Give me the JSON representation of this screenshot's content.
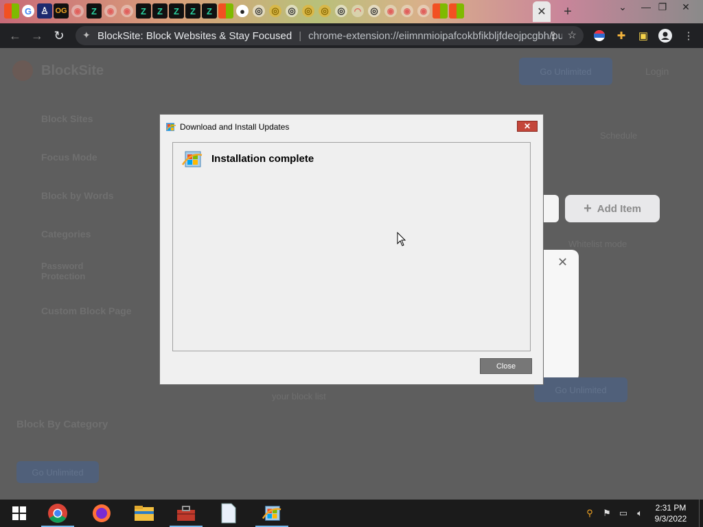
{
  "browser": {
    "tab_favicons": [
      "ms-tile",
      "google",
      "person",
      "og",
      "shield",
      "z-logo",
      "shield",
      "shield",
      "shield",
      "z-logo",
      "z-logo",
      "z-logo",
      "z-logo",
      "z-logo",
      "ms-tile",
      "github",
      "chrome-ring",
      "gold-ring",
      "chrome-ring",
      "gold-ring",
      "gold-ring",
      "chrome-ring",
      "rainbow",
      "chrome-ring",
      "shield",
      "shield",
      "shield",
      "ms-tile",
      "ms-tile"
    ],
    "active_tab_close": "✕",
    "new_tab": "+",
    "window_controls": {
      "minimize": "—",
      "maximize": "❐",
      "close": "✕"
    },
    "page_title": "BlockSite: Block Websites & Stay Focused",
    "url": "chrome-extension://eiimnmioipafcokbfikbljfdeojpcgbh/pu..."
  },
  "blocksite_background": {
    "logo_text": "BlockSite",
    "header_buttons": [
      "Go Unlimited",
      "Login"
    ],
    "sidebar_items": [
      "Block Sites",
      "Focus Mode",
      "Block by Words",
      "Categories",
      "Password Protection",
      "Custom Block Page"
    ],
    "schedule_label": "Schedule",
    "add_item_label": "Add Item",
    "whitelist_label": "Whitelist mode",
    "promo_title": "Block By Category",
    "promo_button": "Go Unlimited",
    "bottom_button": "Go Unlimited",
    "bottom_text": "your block list"
  },
  "dialog": {
    "title": "Download and Install Updates",
    "heading": "Installation complete",
    "close_button": "Close"
  },
  "taskbar": {
    "apps": [
      "start",
      "chrome",
      "firefox",
      "file-explorer",
      "toolbox",
      "notepad-file",
      "windows-update"
    ],
    "time": "2:31 PM",
    "date": "9/3/2022"
  },
  "colors": {
    "dialog_close_x": "#c4463a",
    "taskbar": "#1b1b1b",
    "toolbar": "#202124"
  }
}
